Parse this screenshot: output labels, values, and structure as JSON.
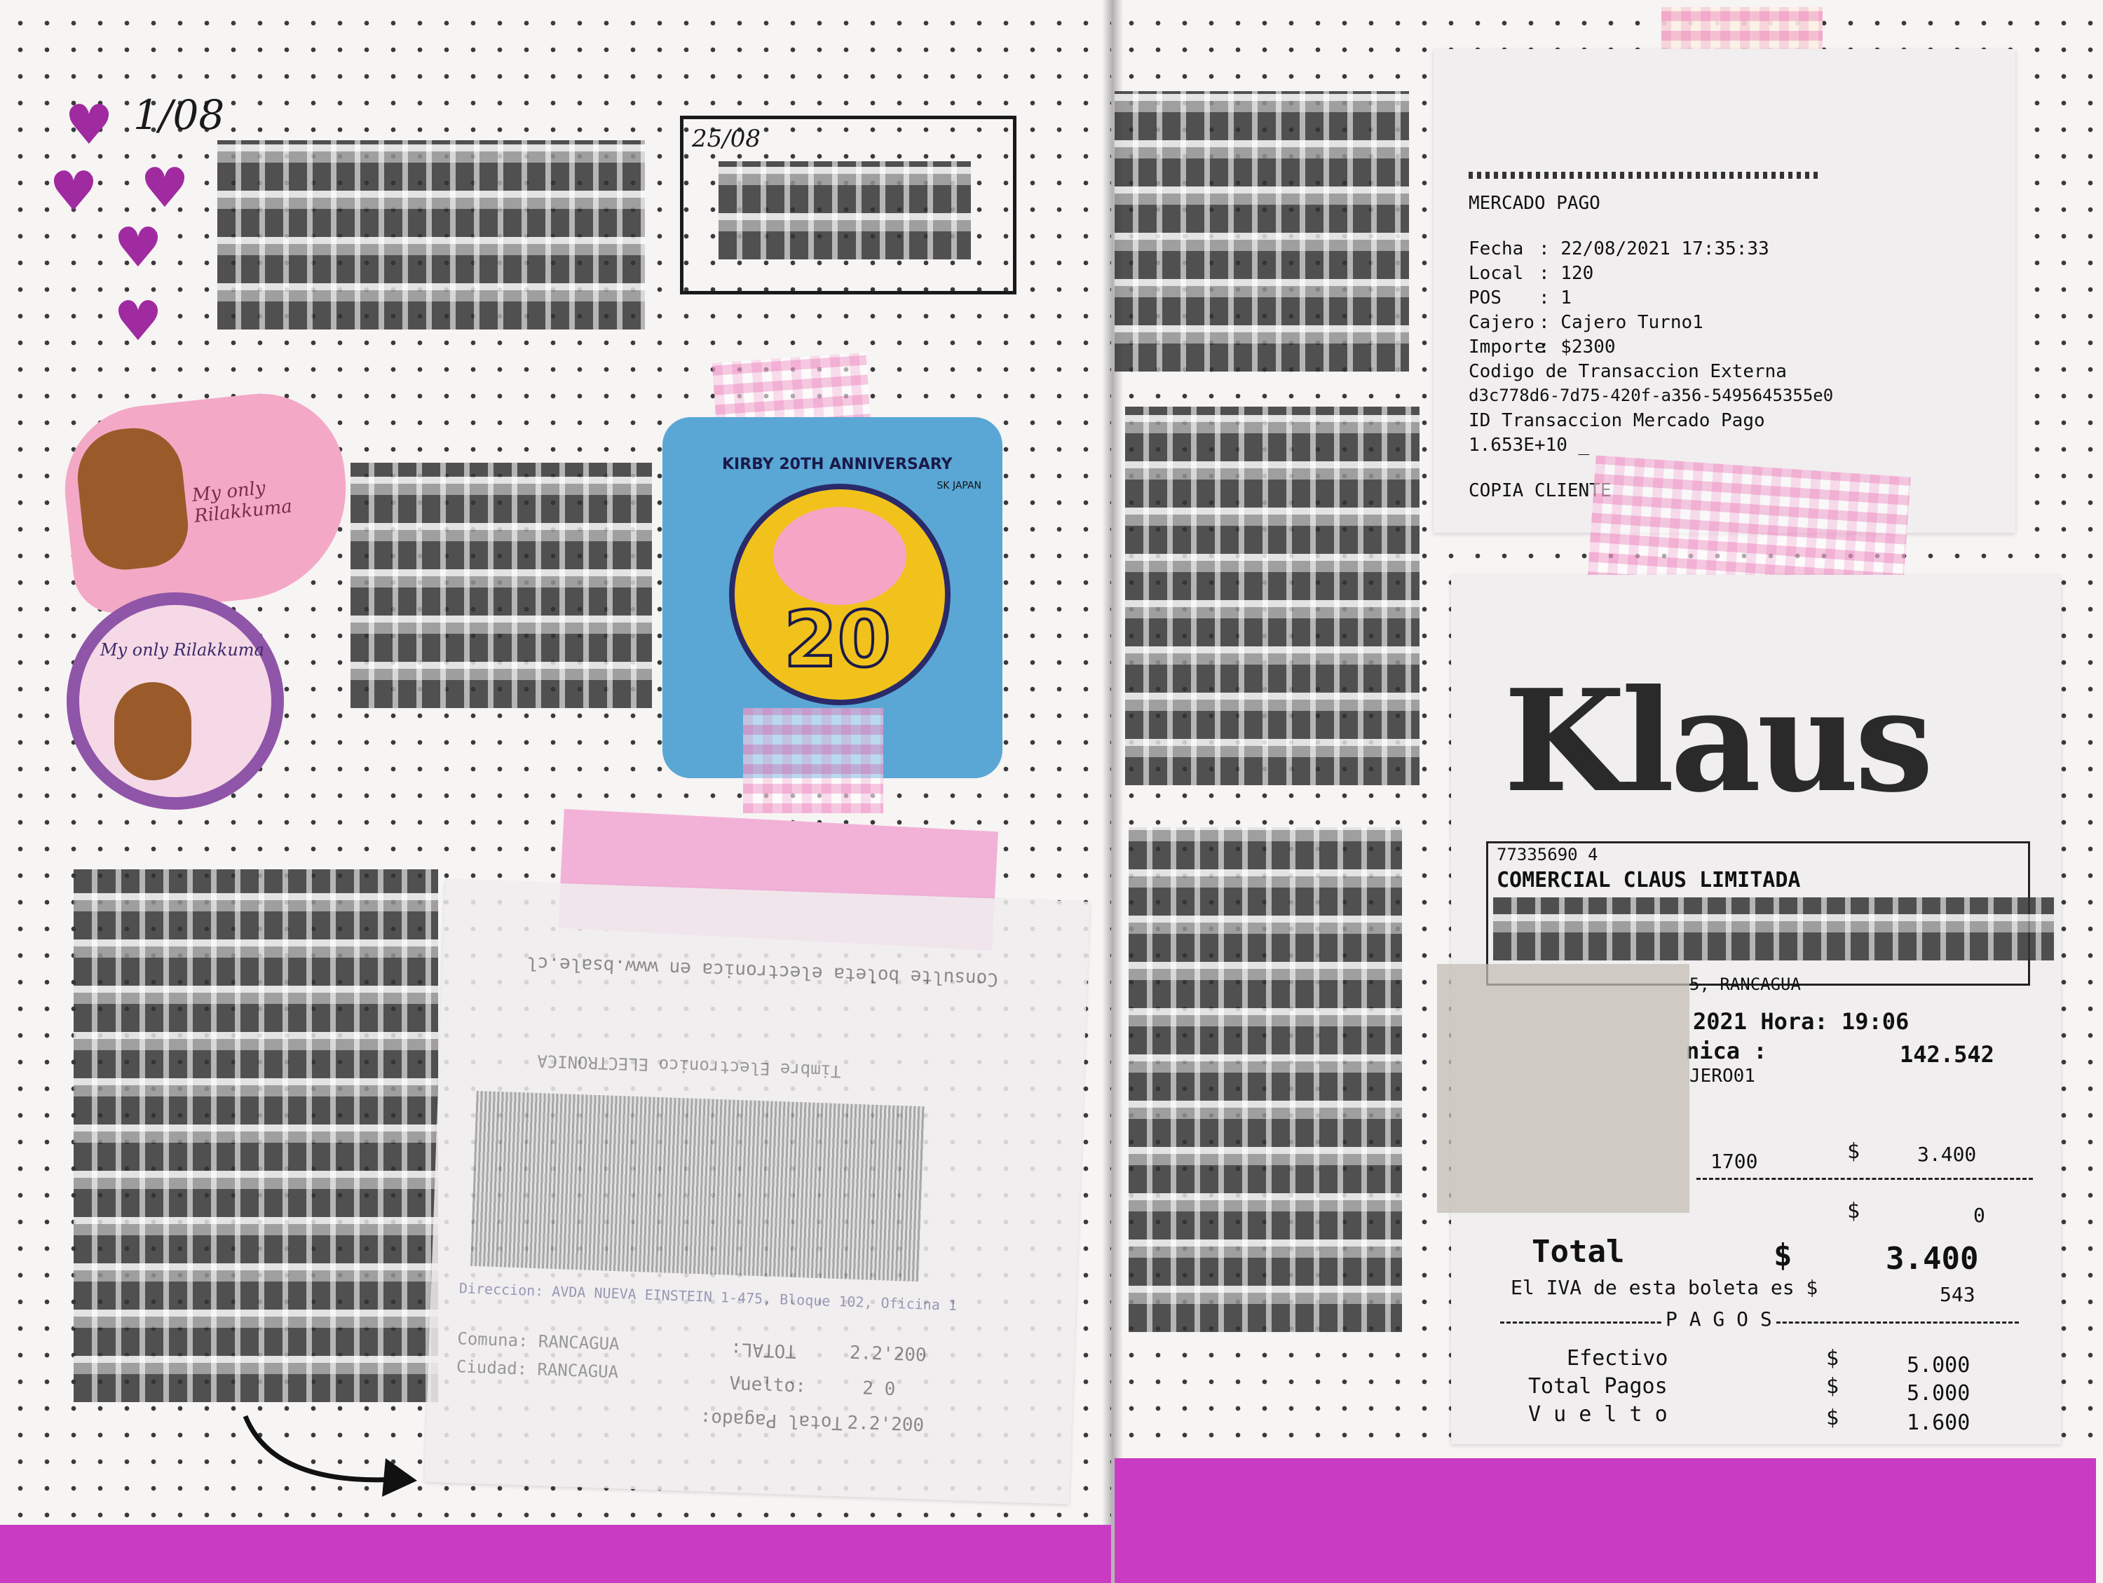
{
  "left_page": {
    "date_top": "1/08",
    "box_date": "25/08",
    "sticker_heart_text": "My only Rilakkuma",
    "sticker_circle_text": "My only Rilakkuma",
    "kirby_sticker": {
      "arc_text": "KIRBY 20TH ANNIVERSARY",
      "number": "20",
      "brand": "SK JAPAN"
    },
    "faded_receipt": {
      "line1": "Consulte boleta electronica en www.bsale.cl",
      "line2": "Timbre Electronico ELECTRONICA",
      "line3": "Direccion: AVDA NUEVA EINSTEIN 1-475, Bloque 102, Oficina 1",
      "comuna": "Comuna: RANCAGUA",
      "ciudad": "Ciudad: RANCAGUA",
      "total_label": "TOTAL:",
      "total_value": "2.2'200",
      "vuelto_label": "Vuelto:",
      "vuelto_value": "2 0",
      "total_pagado_label": "Total Pagado:",
      "total_pagado_value": "2.2'200"
    }
  },
  "mercado_pago": {
    "title": "MERCADO PAGO",
    "fecha_label": "Fecha",
    "fecha_value": ": 22/08/2021 17:35:33",
    "local_label": "Local",
    "local_value": ": 120",
    "pos_label": "POS",
    "pos_value": ": 1",
    "cajero_label": "Cajero",
    "cajero_value": ": Cajero Turno1",
    "importe_label": "Importe",
    "importe_value": ": $2300",
    "codigo_label": "Codigo de Transaccion Externa",
    "codigo_value": "d3c778d6-7d75-420f-a356-5495645355e0",
    "id_label": "ID Transaccion Mercado Pago",
    "id_value": "1.653E+10 _",
    "copia": "COPIA CLIENTE"
  },
  "klaus_receipt": {
    "logo": "Klaus",
    "rut": "77335690 4",
    "company": "COMERCIAL CLAUS LIMITADA",
    "city": "5, RANCAGUA",
    "date_time": "2021 Hora: 19:06",
    "ica_label": "nica :",
    "ica_value": "142.542",
    "cajero": "JERO01",
    "item_code": "1700",
    "item_currency": "$",
    "item_price": "3.400",
    "discount_currency": "$",
    "discount_value": "0",
    "total_label": "Total",
    "total_currency": "$",
    "total_value": "3.400",
    "iva_label": "El IVA de esta boleta es $",
    "iva_value": "543",
    "pagos_label": "P A G O S",
    "efectivo_label": "Efectivo",
    "efectivo_currency": "$",
    "efectivo_value": "5.000",
    "total_pagos_label": "Total Pagos",
    "total_pagos_currency": "$",
    "total_pagos_value": "5.000",
    "vuelto_label": "V u e l t o",
    "vuelto_currency": "$",
    "vuelto_value": "1.600"
  },
  "colors": {
    "magenta_band": "#c93bc2",
    "heart": "#a02aa0",
    "kirby_bg": "#5aa7d6",
    "tape_pink": "#f096c8"
  }
}
